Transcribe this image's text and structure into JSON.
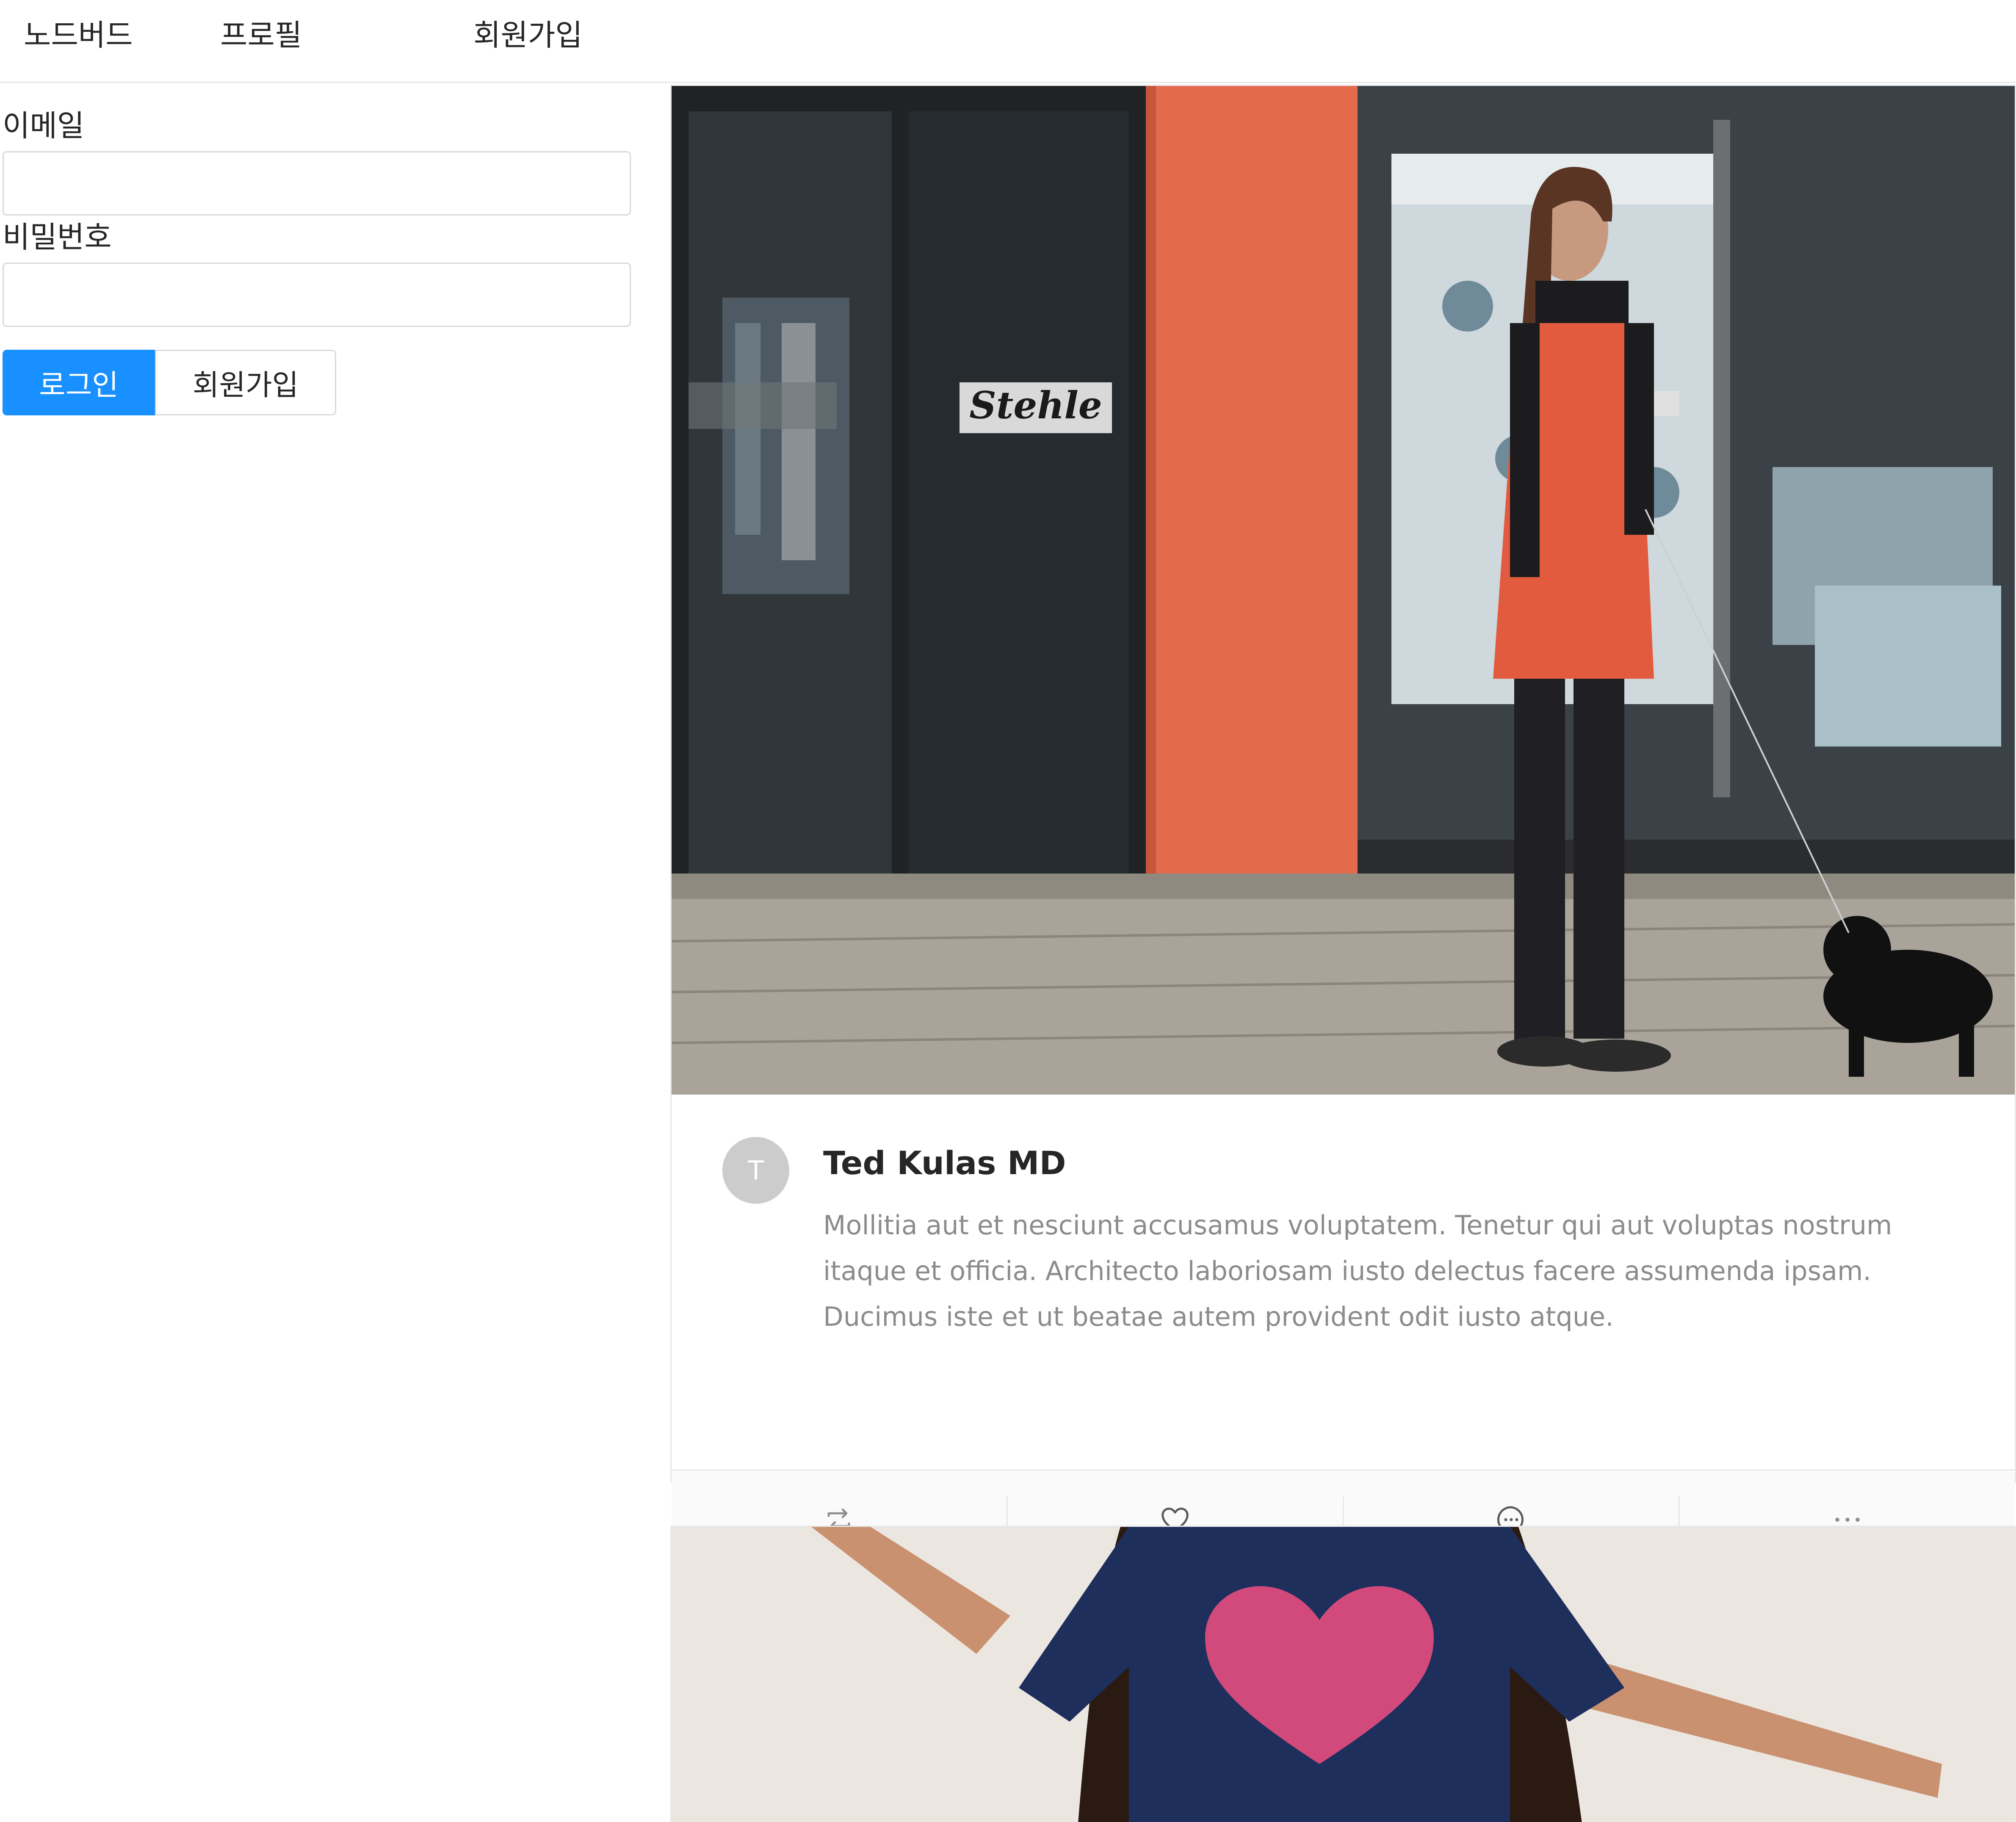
{
  "nav": {
    "items": [
      {
        "label": "노드버드"
      },
      {
        "label": "프로필"
      },
      {
        "label": "회원가입"
      }
    ]
  },
  "login_form": {
    "email_label": "이메일",
    "email_value": "",
    "password_label": "비밀번호",
    "password_value": "",
    "login_button": "로그인",
    "signup_button": "회원가입",
    "primary_color": "#1890ff"
  },
  "feed": {
    "posts": [
      {
        "avatar_letter": "T",
        "author": "Ted Kulas MD",
        "description": "Mollitia aut et nesciunt accusamus voluptatem. Tenetur qui aut voluptas nostrum itaque et officia. Architecto laboriosam iusto delectus facere assumenda ipsam. Ducimus iste et ut beatae autem provident odit iusto atque.",
        "sign_text": "Stehle",
        "actions": [
          {
            "icon": "retweet-icon"
          },
          {
            "icon": "heart-icon"
          },
          {
            "icon": "message-icon"
          },
          {
            "icon": "ellipsis-icon"
          }
        ]
      },
      {
        "cover_icon": "heart-shirt-photo"
      }
    ]
  }
}
